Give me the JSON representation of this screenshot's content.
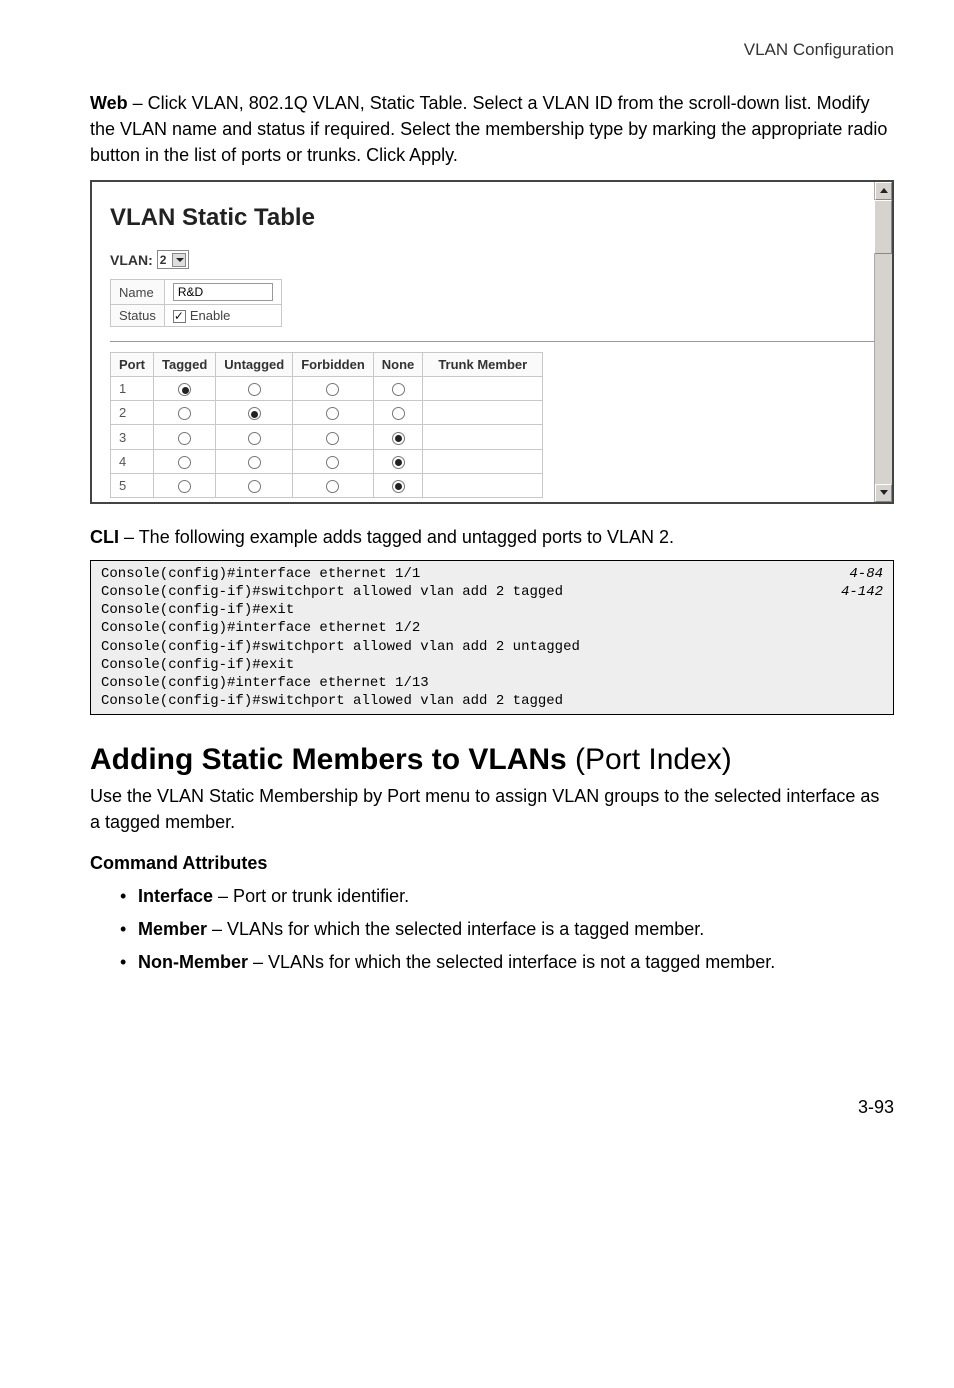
{
  "header": {
    "section": "VLAN Configuration"
  },
  "intro": {
    "bold": "Web",
    "rest": " – Click VLAN, 802.1Q VLAN, Static Table. Select a VLAN ID from the scroll-down list. Modify the VLAN name and status if required. Select the membership type by marking the appropriate radio button in the list of ports or trunks. Click Apply."
  },
  "screenshot": {
    "title": "VLAN Static Table",
    "vlan_label": "VLAN:",
    "vlan_value": "2",
    "name_label": "Name",
    "name_value": "R&D",
    "status_label": "Status",
    "enable_label": "Enable",
    "cols": {
      "port": "Port",
      "tagged": "Tagged",
      "untagged": "Untagged",
      "forbidden": "Forbidden",
      "none": "None",
      "trunk": "Trunk Member"
    },
    "rows": [
      {
        "port": "1",
        "sel": "tagged"
      },
      {
        "port": "2",
        "sel": "untagged"
      },
      {
        "port": "3",
        "sel": "none"
      },
      {
        "port": "4",
        "sel": "none"
      },
      {
        "port": "5",
        "sel": "none"
      }
    ]
  },
  "cli_note": {
    "bold": "CLI",
    "rest": " – The following example adds tagged and untagged ports to VLAN 2."
  },
  "cli": {
    "left": "Console(config)#interface ethernet 1/1\nConsole(config-if)#switchport allowed vlan add 2 tagged\nConsole(config-if)#exit\nConsole(config)#interface ethernet 1/2\nConsole(config-if)#switchport allowed vlan add 2 untagged\nConsole(config-if)#exit\nConsole(config)#interface ethernet 1/13\nConsole(config-if)#switchport allowed vlan add 2 tagged",
    "right": "4-84\n4-142\n\n\n\n\n\n"
  },
  "section2": {
    "title_bold": "Adding Static Members to VLANs",
    "title_light": " (Port Index)",
    "body": "Use the VLAN Static Membership by Port menu to assign VLAN groups to the selected interface as a tagged member.",
    "cmd_attr_title": "Command Attributes",
    "items": [
      {
        "b": "Interface",
        "rest": " – Port or trunk identifier."
      },
      {
        "b": "Member",
        "rest": " – VLANs for which the selected interface is a tagged member."
      },
      {
        "b": "Non-Member",
        "rest": " – VLANs for which the selected interface is not a tagged member."
      }
    ]
  },
  "footer": {
    "page": "3-93"
  }
}
